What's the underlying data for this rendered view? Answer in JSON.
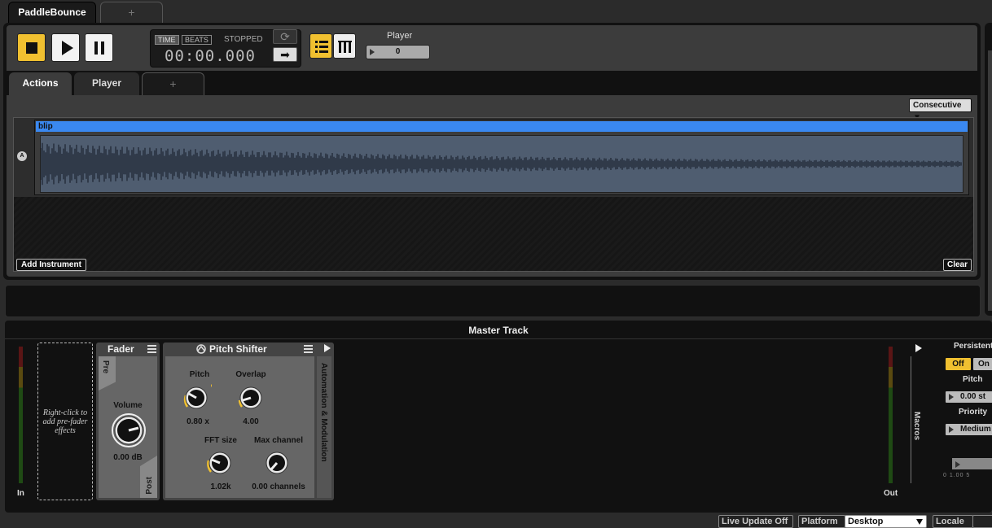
{
  "top_tabs": {
    "active": "PaddleBounce",
    "add": "+"
  },
  "transport": {
    "time_tag": "TIME",
    "beats_tag": "BEATS",
    "status": "STOPPED",
    "time": "00:00.000",
    "loop_icon": "⟳",
    "arrow_icon": "➡"
  },
  "player": {
    "label": "Player",
    "value": "0"
  },
  "inner_tabs": {
    "actions": "Actions",
    "player": "Player",
    "add": "+"
  },
  "mode_select": "Consecutive ▼",
  "track": {
    "row_label": "A",
    "clip_name": "blip",
    "add_instrument": "Add Instrument",
    "clear": "Clear"
  },
  "master": {
    "title": "Master Track",
    "in_label": "In",
    "out_label": "Out",
    "prefader_hint": "Right-click to add pre-fader effects",
    "fader": {
      "title": "Fader",
      "pre": "Pre",
      "post": "Post",
      "volume_label": "Volume",
      "volume_value": "0.00 dB"
    },
    "pitch_shifter": {
      "title": "Pitch Shifter",
      "automation": "Automation & Modulation",
      "knobs": [
        {
          "label": "Pitch",
          "value": "0.80 x"
        },
        {
          "label": "Overlap",
          "value": "4.00"
        },
        {
          "label": "FFT size",
          "value": "1.02k"
        },
        {
          "label": "Max channel",
          "value": "0.00 channels"
        }
      ]
    },
    "macros": "Macros",
    "side": {
      "persistent_label": "Persistent",
      "off": "Off",
      "on": "On",
      "pitch_label": "Pitch",
      "pitch_value": "0.00 st",
      "priority_label": "Priority",
      "priority_value": "Medium",
      "slider_scale": "0   1.00   5"
    }
  },
  "status_bar": {
    "live_update": "Live Update Off",
    "platform_label": "Platform",
    "platform_value": "Desktop",
    "locale_label": "Locale",
    "colors": {
      "accent": "#f0c030",
      "clip_header": "#3a88f0"
    }
  }
}
